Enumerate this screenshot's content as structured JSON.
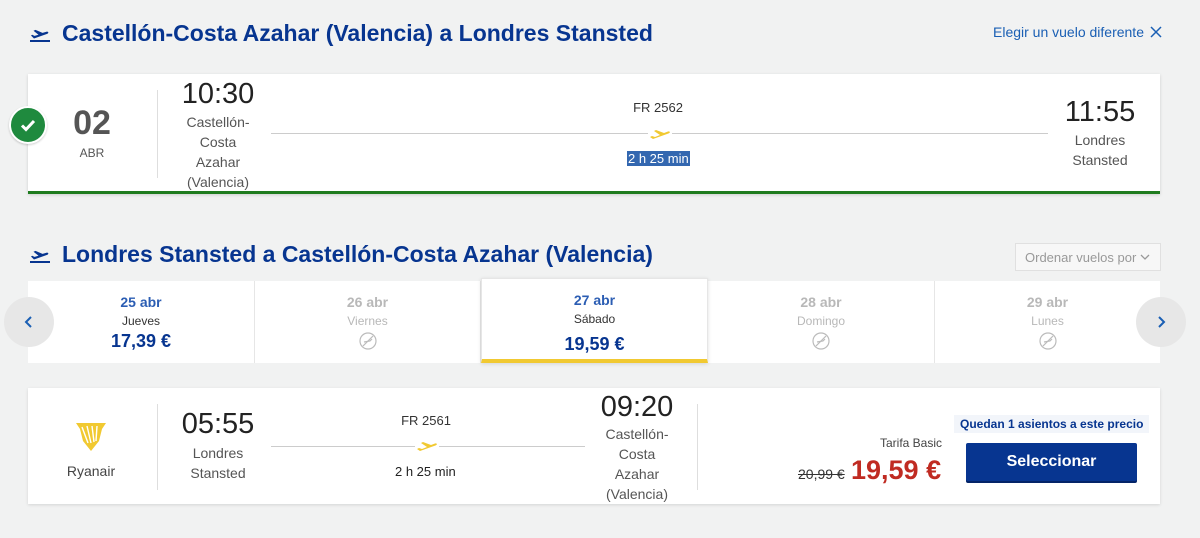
{
  "outbound": {
    "title": "Castellón-Costa Azahar (Valencia) a Londres Stansted",
    "change_link": "Elegir un vuelo diferente",
    "date_day": "02",
    "date_month": "ABR",
    "depart_time": "10:30",
    "depart_place": "Castellón-Costa Azahar (Valencia)",
    "flight_number": "FR 2562",
    "duration": "2 h 25 min",
    "arrive_time": "11:55",
    "arrive_place": "Londres Stansted"
  },
  "inbound": {
    "title": "Londres Stansted a Castellón-Costa Azahar (Valencia)",
    "sort_label": "Ordenar vuelos por",
    "dates": [
      {
        "date": "25 abr",
        "day": "Jueves",
        "price": "17,39 €",
        "available": true
      },
      {
        "date": "26 abr",
        "day": "Viernes",
        "price": "",
        "available": false
      },
      {
        "date": "27 abr",
        "day": "Sábado",
        "price": "19,59 €",
        "available": true
      },
      {
        "date": "28 abr",
        "day": "Domingo",
        "price": "",
        "available": false
      },
      {
        "date": "29 abr",
        "day": "Lunes",
        "price": "",
        "available": false
      }
    ],
    "flight": {
      "airline": "Ryanair",
      "depart_time": "05:55",
      "depart_place": "Londres Stansted",
      "flight_number": "FR 2561",
      "duration": "2 h 25 min",
      "arrive_time": "09:20",
      "arrive_place": "Castellón-Costa Azahar (Valencia)",
      "fare_label": "Tarifa Basic",
      "old_price": "20,99 €",
      "price": "19,59 €",
      "seats_note": "Quedan 1 asientos a este precio",
      "select_label": "Seleccionar"
    }
  },
  "colors": {
    "brand_blue": "#073590",
    "accent_yellow": "#f1c931",
    "price_red": "#c02b22",
    "success_green": "#1f8a3e"
  }
}
